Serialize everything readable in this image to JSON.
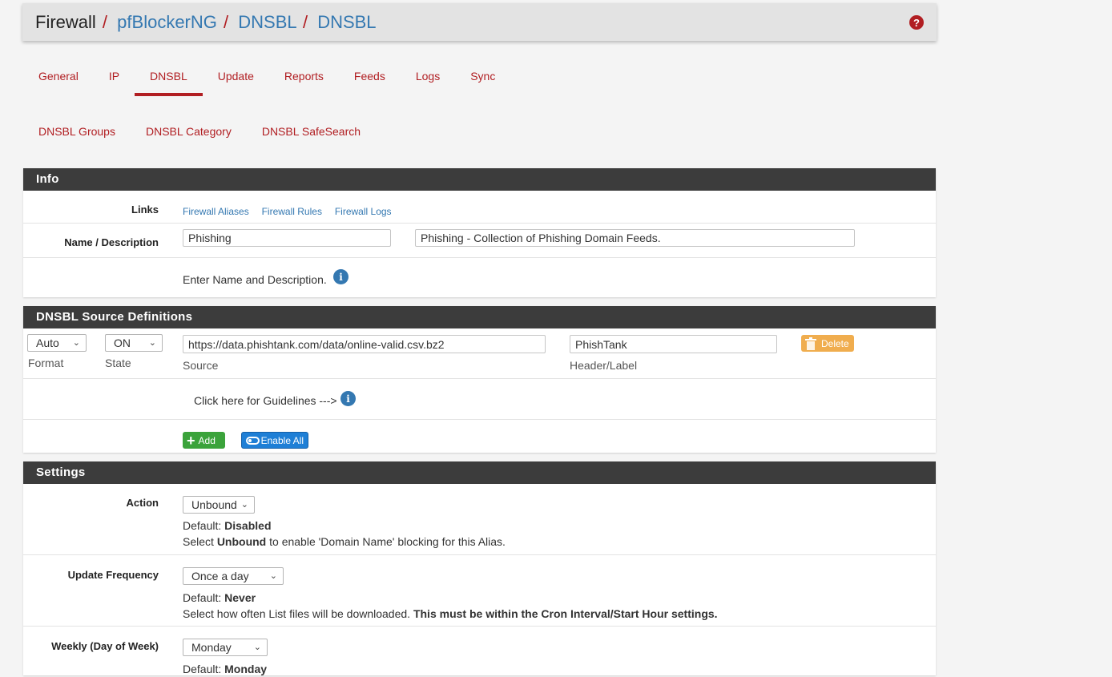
{
  "breadcrumb": {
    "root": "Firewall",
    "items": [
      "pfBlockerNG",
      "DNSBL",
      "DNSBL"
    ],
    "sep": "/"
  },
  "help_icon": "?",
  "tabs": [
    "General",
    "IP",
    "DNSBL",
    "Update",
    "Reports",
    "Feeds",
    "Logs",
    "Sync"
  ],
  "active_tab": "DNSBL",
  "subtabs": [
    "DNSBL Groups",
    "DNSBL Category",
    "DNSBL SafeSearch"
  ],
  "info": {
    "title": "Info",
    "links_label": "Links",
    "links": [
      "Firewall Aliases",
      "Firewall Rules",
      "Firewall Logs"
    ],
    "name_label": "Name / Description",
    "name_value": "Phishing",
    "description_value": "Phishing - Collection of Phishing Domain Feeds.",
    "help_text": "Enter Name and Description."
  },
  "sources": {
    "title": "DNSBL Source Definitions",
    "format_value": "Auto",
    "format_label": "Format",
    "state_value": "ON",
    "state_label": "State",
    "source_value": "https://data.phishtank.com/data/online-valid.csv.bz2",
    "source_label": "Source",
    "header_value": "PhishTank",
    "header_label": "Header/Label",
    "delete_label": "Delete",
    "guidelines_text": "Click here for Guidelines --->",
    "add_label": "Add",
    "enable_all_label": "Enable All"
  },
  "settings": {
    "title": "Settings",
    "action": {
      "label": "Action",
      "value": "Unbound",
      "default_prefix": "Default: ",
      "default_value": "Disabled",
      "help_pre": "Select ",
      "help_bold": "Unbound",
      "help_post": " to enable 'Domain Name' blocking for this Alias."
    },
    "update_frequency": {
      "label": "Update Frequency",
      "value": "Once a day",
      "default_prefix": "Default: ",
      "default_value": "Never",
      "help_pre": "Select how often List files will be downloaded. ",
      "help_bold": "This must be within the Cron Interval/Start Hour settings."
    },
    "weekly": {
      "label": "Weekly (Day of Week)",
      "value": "Monday",
      "default_prefix": "Default: ",
      "default_value": "Monday"
    }
  },
  "colors": {
    "accent": "#b11e22",
    "link": "#3478b1",
    "panel_head": "#3c3c3c",
    "delete_btn": "#f0ad4e",
    "add_btn": "#3ba33b",
    "enable_btn": "#1e7fd6"
  },
  "chevron_icon": "⌄"
}
